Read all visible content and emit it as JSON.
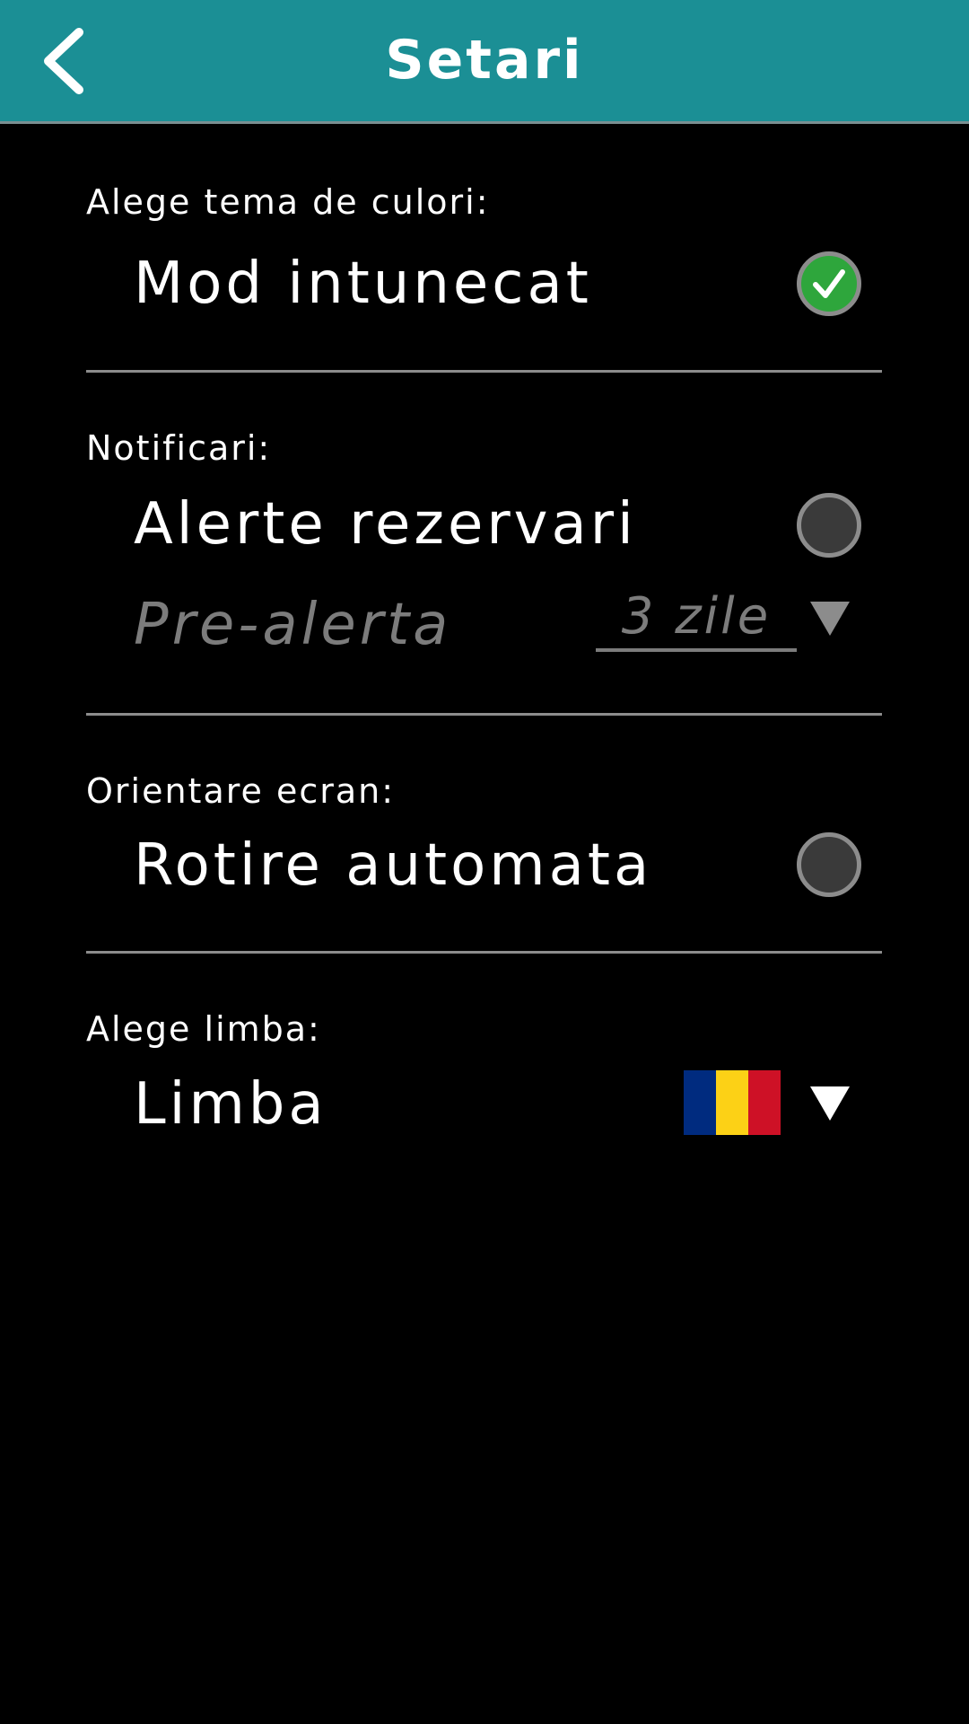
{
  "header": {
    "title": "Setari",
    "background": "#1b8f95"
  },
  "theme": {
    "section_label": "Alege tema de culori:",
    "option_label": "Mod intunecat",
    "checked": true,
    "check_color": "#2ea63c"
  },
  "notifications": {
    "section_label": "Notificari:",
    "option_label": "Alerte rezervari",
    "checked": false,
    "pre_alert_label": "Pre-alerta",
    "pre_alert_value": "3 zile",
    "pre_alert_enabled": false
  },
  "orientation": {
    "section_label": "Orientare ecran:",
    "option_label": "Rotire automata",
    "checked": false
  },
  "language": {
    "section_label": "Alege limba:",
    "option_label": "Limba",
    "flag_colors": [
      "#002b7f",
      "#fcd116",
      "#ce1126"
    ]
  }
}
